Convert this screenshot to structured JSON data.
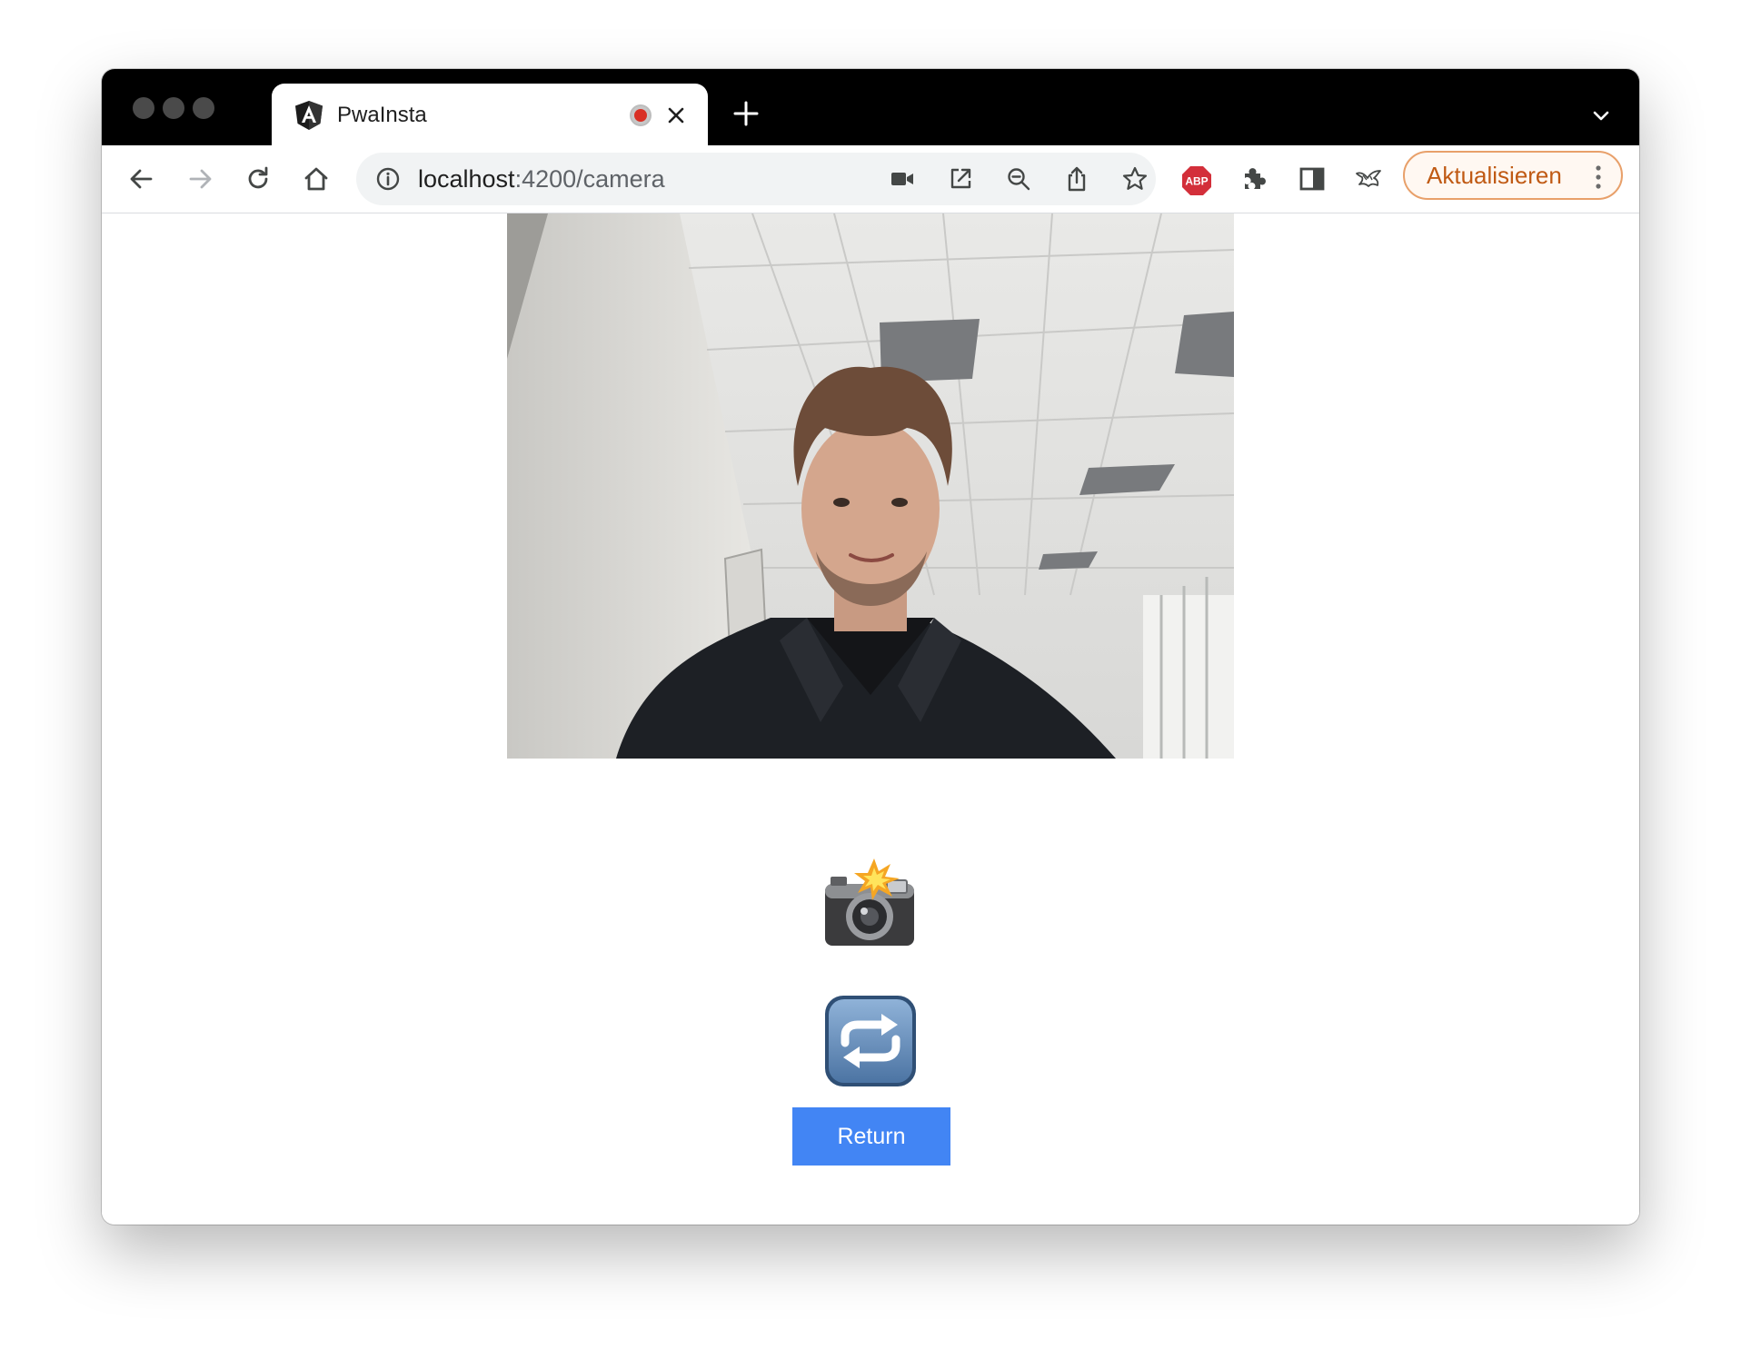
{
  "browser": {
    "tab": {
      "title": "PwaInsta",
      "favicon": "angular-icon",
      "recording_indicator": "record-icon",
      "close_icon": "close-icon"
    },
    "new_tab_icon": "plus-icon",
    "tab_search_icon": "chevron-down-icon",
    "nav": {
      "back_icon": "back-arrow-icon",
      "forward_icon": "forward-arrow-icon",
      "reload_icon": "reload-icon",
      "home_icon": "home-icon"
    },
    "omnibox": {
      "info_icon": "info-icon",
      "url_host": "localhost",
      "url_rest": ":4200/camera",
      "icons": [
        "video-camera-icon",
        "open-external-icon",
        "zoom-out-icon",
        "share-icon",
        "star-icon"
      ]
    },
    "extensions": {
      "adblock_label": "ABP",
      "icons": [
        "adblock-icon",
        "puzzle-icon",
        "sidebar-icon",
        "bird-icon"
      ]
    },
    "update_button": {
      "label": "Aktualisieren",
      "menu_icon": "kebab-menu-icon"
    },
    "colors": {
      "tabbar": "#000000",
      "update_text": "#c05a14",
      "update_border": "#e8a06a",
      "record": "#d93025"
    }
  },
  "page": {
    "camera_feed": "webcam-video",
    "snap_button_icon": "camera-with-flash-icon",
    "switch_camera_icon": "repeat-arrows-icon",
    "return_button": {
      "label": "Return",
      "color": "#4285f4"
    }
  }
}
